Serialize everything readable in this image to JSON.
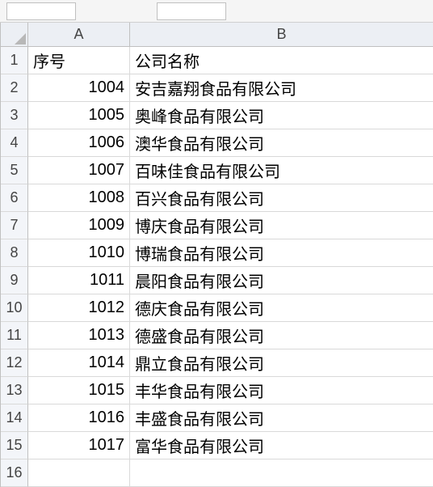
{
  "toolbar": {
    "box1": "",
    "box2": ""
  },
  "columns": [
    "A",
    "B"
  ],
  "row_numbers": [
    1,
    2,
    3,
    4,
    5,
    6,
    7,
    8,
    9,
    10,
    11,
    12,
    13,
    14,
    15,
    16
  ],
  "header": {
    "a": "序号",
    "b": "公司名称"
  },
  "rows": [
    {
      "a": "1004",
      "b": "安吉嘉翔食品有限公司"
    },
    {
      "a": "1005",
      "b": "奥峰食品有限公司"
    },
    {
      "a": "1006",
      "b": "澳华食品有限公司"
    },
    {
      "a": "1007",
      "b": "百味佳食品有限公司"
    },
    {
      "a": "1008",
      "b": "百兴食品有限公司"
    },
    {
      "a": "1009",
      "b": "博庆食品有限公司"
    },
    {
      "a": "1010",
      "b": "博瑞食品有限公司"
    },
    {
      "a": "1011",
      "b": "晨阳食品有限公司"
    },
    {
      "a": "1012",
      "b": "德庆食品有限公司"
    },
    {
      "a": "1013",
      "b": "德盛食品有限公司"
    },
    {
      "a": "1014",
      "b": "鼎立食品有限公司"
    },
    {
      "a": "1015",
      "b": "丰华食品有限公司"
    },
    {
      "a": "1016",
      "b": "丰盛食品有限公司"
    },
    {
      "a": "1017",
      "b": "富华食品有限公司"
    }
  ],
  "chart_data": {
    "type": "table",
    "columns": [
      "序号",
      "公司名称"
    ],
    "data": [
      [
        1004,
        "安吉嘉翔食品有限公司"
      ],
      [
        1005,
        "奥峰食品有限公司"
      ],
      [
        1006,
        "澳华食品有限公司"
      ],
      [
        1007,
        "百味佳食品有限公司"
      ],
      [
        1008,
        "百兴食品有限公司"
      ],
      [
        1009,
        "博庆食品有限公司"
      ],
      [
        1010,
        "博瑞食品有限公司"
      ],
      [
        1011,
        "晨阳食品有限公司"
      ],
      [
        1012,
        "德庆食品有限公司"
      ],
      [
        1013,
        "德盛食品有限公司"
      ],
      [
        1014,
        "鼎立食品有限公司"
      ],
      [
        1015,
        "丰华食品有限公司"
      ],
      [
        1016,
        "丰盛食品有限公司"
      ],
      [
        1017,
        "富华食品有限公司"
      ]
    ]
  }
}
